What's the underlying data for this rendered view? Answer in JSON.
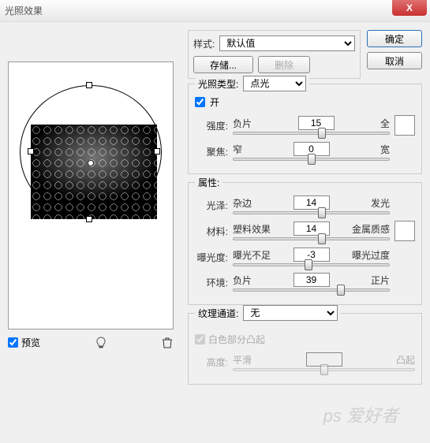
{
  "window": {
    "title": "光照效果",
    "close": "X"
  },
  "buttons": {
    "ok": "确定",
    "cancel": "取消",
    "save": "存储...",
    "delete": "删除"
  },
  "style": {
    "label": "样式:",
    "value": "默认值"
  },
  "light_type": {
    "label": "光照类型:",
    "value": "点光",
    "on_label": "开",
    "on_checked": true
  },
  "sliders": {
    "intensity": {
      "label": "强度:",
      "left": "负片",
      "right": "全",
      "value": 15,
      "pos": 57
    },
    "focus": {
      "label": "聚焦:",
      "left": "窄",
      "right": "宽",
      "value": 0,
      "pos": 50
    },
    "gloss": {
      "label": "光泽:",
      "left": "杂边",
      "right": "发光",
      "value": 14,
      "pos": 57
    },
    "material": {
      "label": "材料:",
      "left": "塑料效果",
      "right": "金属质感",
      "value": 14,
      "pos": 57
    },
    "exposure": {
      "label": "曝光度:",
      "left": "曝光不足",
      "right": "曝光过度",
      "value": -3,
      "pos": 48
    },
    "ambience": {
      "label": "环境:",
      "left": "负片",
      "right": "正片",
      "value": 39,
      "pos": 69
    },
    "height": {
      "label": "高度:",
      "left": "平滑",
      "right": "凸起",
      "value": "",
      "pos": 50
    }
  },
  "attributes": {
    "label": "属性:"
  },
  "texture": {
    "channel_label": "纹理通道:",
    "channel_value": "无",
    "white_high_label": "白色部分凸起",
    "white_high_checked": true
  },
  "preview": {
    "label": "预览",
    "checked": true
  },
  "watermark": "ps 爱好者"
}
